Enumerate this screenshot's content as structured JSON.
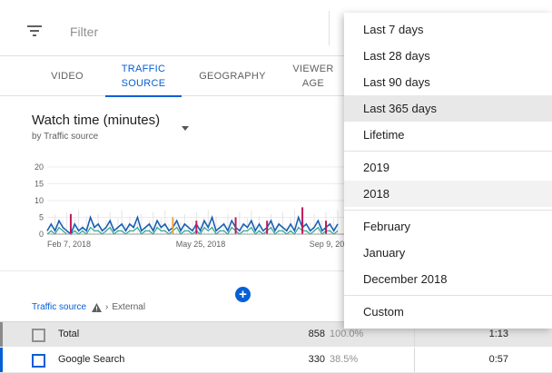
{
  "filter": {
    "placeholder": "Filter"
  },
  "tabs": [
    {
      "line1": "VIDEO",
      "line2": ""
    },
    {
      "line1": "TRAFFIC",
      "line2": "SOURCE"
    },
    {
      "line1": "GEOGRAPHY",
      "line2": ""
    },
    {
      "line1": "VIEWER",
      "line2": "AGE"
    }
  ],
  "metric": {
    "title": "Watch time (minutes)",
    "subtitle": "by Traffic source"
  },
  "chart_data": {
    "type": "line",
    "yticks": [
      "20",
      "15",
      "10",
      "5",
      "0"
    ],
    "ylim": [
      0,
      20
    ],
    "xticks": [
      "Feb 7, 2018",
      "May 25, 2018",
      "Sep 9, 20"
    ],
    "grid": true,
    "series": [
      {
        "color": "#1a5fb4",
        "values": [
          1,
          3,
          1,
          4,
          2,
          1,
          0,
          3,
          1,
          2,
          1,
          5,
          2,
          3,
          1,
          2,
          4,
          1,
          2,
          3,
          1,
          3,
          2,
          5,
          1,
          2,
          3,
          1,
          4,
          2,
          3,
          1,
          2,
          4,
          1,
          3,
          2,
          1,
          3,
          1,
          4,
          2,
          5,
          1,
          2,
          3,
          1,
          4,
          2,
          1,
          3,
          2,
          4,
          1,
          3,
          1,
          2,
          4,
          1,
          3,
          2,
          1,
          3,
          1,
          5,
          2,
          3,
          1,
          2,
          4,
          1,
          2,
          3,
          1,
          3
        ]
      },
      {
        "color": "#1b9e8a",
        "values": [
          0,
          1,
          0,
          2,
          1,
          0,
          0,
          1,
          0,
          1,
          0,
          2,
          1,
          1,
          0,
          1,
          2,
          0,
          1,
          1,
          0,
          1,
          1,
          2,
          0,
          1,
          1,
          0,
          2,
          1,
          1,
          0,
          1,
          2,
          0,
          1,
          1,
          0,
          1,
          0,
          2,
          1,
          2,
          0,
          1,
          1,
          0,
          2,
          1,
          0,
          1,
          1,
          2,
          0,
          1,
          0,
          1,
          2,
          0,
          1,
          1,
          0,
          1,
          0,
          2,
          1,
          1,
          0,
          1,
          2,
          0,
          1,
          1,
          0,
          1
        ]
      },
      {
        "color": "#c2185b",
        "values": [
          0,
          0,
          0,
          0,
          0,
          0,
          0,
          0,
          0,
          0,
          0,
          0,
          0,
          0,
          0,
          0,
          0,
          0,
          0,
          0,
          0,
          0,
          0,
          0,
          0,
          0,
          0,
          0,
          0,
          0,
          0,
          0,
          0,
          0,
          0,
          0,
          0,
          0,
          0,
          0,
          0,
          0,
          0,
          0,
          0,
          0,
          0,
          0,
          0,
          0,
          0,
          0,
          0,
          0,
          0,
          0,
          0,
          0,
          0,
          0,
          0,
          0,
          0,
          0,
          0,
          0,
          0,
          0,
          0,
          0,
          0,
          0,
          0,
          0,
          0
        ]
      }
    ],
    "spikes": [
      {
        "x_index": 6,
        "value": 6,
        "color": "#c2185b"
      },
      {
        "x_index": 32,
        "value": 5,
        "color": "#f2a23a"
      },
      {
        "x_index": 38,
        "value": 4,
        "color": "#c2185b"
      },
      {
        "x_index": 48,
        "value": 5,
        "color": "#c2185b"
      },
      {
        "x_index": 56,
        "value": 4,
        "color": "#c2185b"
      },
      {
        "x_index": 65,
        "value": 8,
        "color": "#c2185b"
      },
      {
        "x_index": 71,
        "value": 4,
        "color": "#c2185b"
      }
    ]
  },
  "breadcrumb": {
    "link": "Traffic source",
    "chevron": "›",
    "current": "External"
  },
  "add_button": {
    "label": "+"
  },
  "table": {
    "rows": [
      {
        "label": "Total",
        "value": "858",
        "pct": "100.0%",
        "duration": "1:13",
        "bar_color": "#8a8a8a"
      },
      {
        "label": "Google Search",
        "value": "330",
        "pct": "38.5%",
        "duration": "0:57",
        "bar_color": "#065fd4"
      }
    ]
  },
  "menu": {
    "groups": [
      [
        {
          "label": "Last 7 days"
        },
        {
          "label": "Last 28 days"
        },
        {
          "label": "Last 90 days"
        },
        {
          "label": "Last 365 days",
          "state": "highlight"
        },
        {
          "label": "Lifetime"
        }
      ],
      [
        {
          "label": "2019"
        },
        {
          "label": "2018",
          "state": "soft"
        }
      ],
      [
        {
          "label": "February"
        },
        {
          "label": "January"
        },
        {
          "label": "December 2018"
        }
      ],
      [
        {
          "label": "Custom"
        }
      ]
    ]
  }
}
